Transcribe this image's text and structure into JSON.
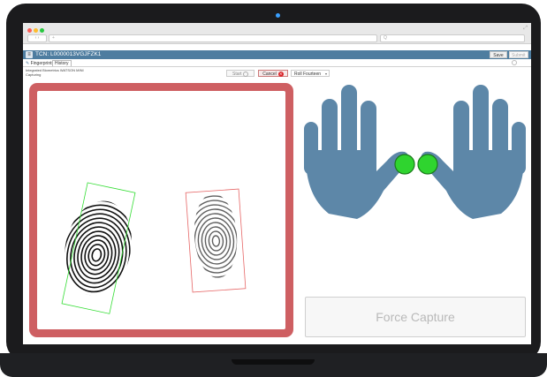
{
  "browser": {
    "nav_glyph": "‹ ›",
    "url_placeholder": "+",
    "search_placeholder": "Q",
    "expand_glyph": "⤢",
    "traffic_colors": [
      "#ff5f57",
      "#febc2e",
      "#28c840"
    ]
  },
  "app": {
    "tcn": "TCN: L0000013VGJFZK1",
    "menu_glyph": "≡",
    "save_label": "Save",
    "submit_label": "Submit"
  },
  "tabs": [
    {
      "label": "Fingerprints",
      "icon": "fingerprint-icon"
    },
    {
      "label": "History"
    }
  ],
  "device_name": "Integrated Biometrics WATSON MINI",
  "status_text": "Capturing",
  "toolbar": {
    "start_label": "Start",
    "cancel_label": "Cancel",
    "cancel_icon": "close-circle-icon",
    "select_value": "Roll Fourteen"
  },
  "capture": {
    "frame_color": "#ce5f62",
    "good_box_color": "#33dd33",
    "bad_box_color": "#e66666"
  },
  "hands": {
    "color": "#5d87a8",
    "thumb_indicator_color": "#2fd42f",
    "active_fingers": [
      "left-thumb",
      "right-thumb"
    ]
  },
  "force_capture_label": "Force Capture"
}
